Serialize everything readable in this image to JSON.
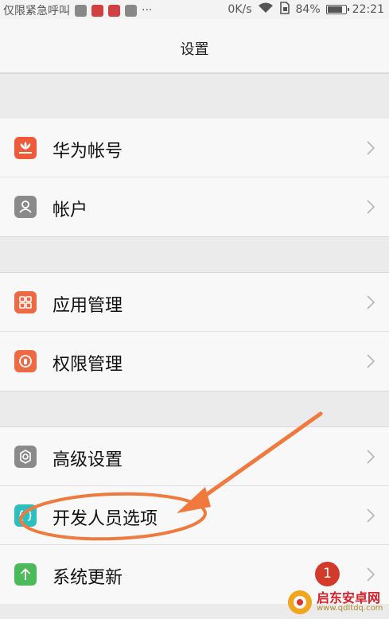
{
  "status_bar": {
    "left_text": "仅限紧急呼叫",
    "more": "···",
    "speed": "0K/s",
    "battery_percent": "84%",
    "battery_level": 0.84,
    "time": "22:21",
    "app_icon_colors": [
      "#888888",
      "#d04040",
      "#d04040",
      "#888888"
    ]
  },
  "title": "设置",
  "groups": [
    {
      "rows": [
        {
          "label": "华为帐号",
          "icon": "huawei-icon",
          "color": "#ee5a3a"
        },
        {
          "label": "帐户",
          "icon": "account-icon",
          "color": "#8a8a8a"
        }
      ]
    },
    {
      "rows": [
        {
          "label": "应用管理",
          "icon": "app-grid-icon",
          "color": "#ee6a45"
        },
        {
          "label": "权限管理",
          "icon": "permission-icon",
          "color": "#ee6a45"
        }
      ]
    },
    {
      "rows": [
        {
          "label": "高级设置",
          "icon": "gear-icon",
          "color": "#8a8a8a"
        },
        {
          "label": "开发人员选项",
          "icon": "code-braces-icon",
          "color": "#2bbfc0"
        },
        {
          "label": "系统更新",
          "icon": "update-arrow-icon",
          "color": "#4cba5a",
          "badge": "1"
        }
      ]
    }
  ],
  "annotation": {
    "color": "#f07a3e"
  },
  "watermark": {
    "title": "启东安卓网",
    "url": "www.qdltdq.com"
  }
}
